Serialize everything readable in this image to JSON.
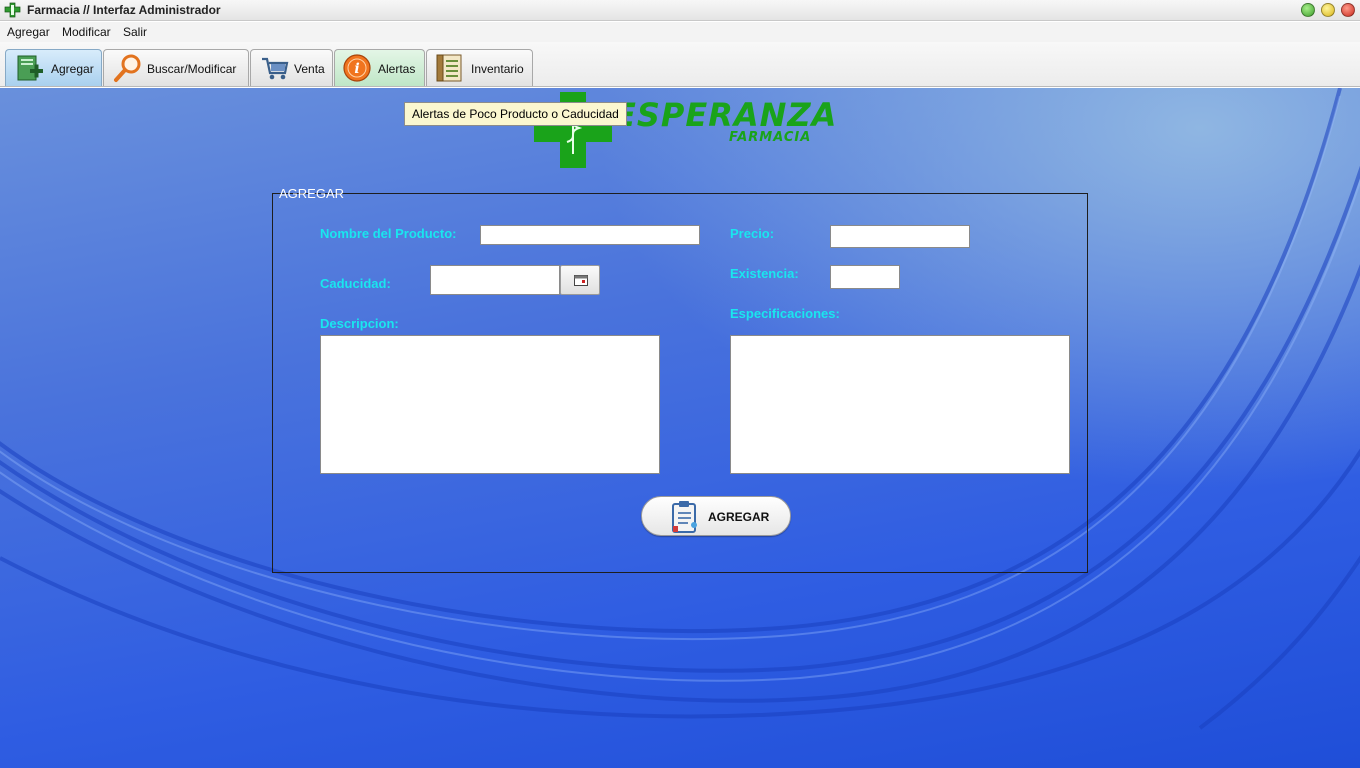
{
  "window": {
    "title": "Farmacia // Interfaz Administrador",
    "app_icon": "pharmacy-cross-icon",
    "controls": [
      "minimize",
      "maximize",
      "close"
    ]
  },
  "menubar": {
    "items": [
      {
        "label": "Agregar"
      },
      {
        "label": "Modificar"
      },
      {
        "label": "Salir"
      }
    ]
  },
  "tabs": [
    {
      "label": "Agregar",
      "icon": "add-document-icon",
      "selected": true
    },
    {
      "label": "Buscar/Modificar",
      "icon": "magnifier-icon",
      "selected": false
    },
    {
      "label": "Venta",
      "icon": "shopping-cart-icon",
      "selected": false
    },
    {
      "label": "Alertas",
      "icon": "info-alert-icon",
      "selected": false,
      "hovered": true
    },
    {
      "label": "Inventario",
      "icon": "inventory-list-icon",
      "selected": false
    }
  ],
  "tooltip": {
    "text": "Alertas de Poco Producto o Caducidad"
  },
  "logo": {
    "main": "ESPERANZA",
    "sub": "FARMACIA",
    "color": "#1aa31a"
  },
  "form": {
    "legend": "AGREGAR",
    "labels": {
      "nombre": "Nombre del Producto:",
      "precio": "Precio:",
      "caducidad": "Caducidad:",
      "existencia": "Existencia:",
      "descripcion": "Descripcion:",
      "especificaciones": "Especificaciones:"
    },
    "values": {
      "nombre": "",
      "precio": "",
      "caducidad": "",
      "existencia": "",
      "descripcion": "",
      "especificaciones": ""
    },
    "calendar_icon": "calendar-icon",
    "submit": {
      "label": "AGREGAR",
      "icon": "clipboard-icon"
    }
  },
  "colors": {
    "label": "#19e6ef",
    "background": "#2f5de2",
    "tab_selected": "#a9d0ee",
    "tooltip_bg": "#fbf7d0"
  }
}
